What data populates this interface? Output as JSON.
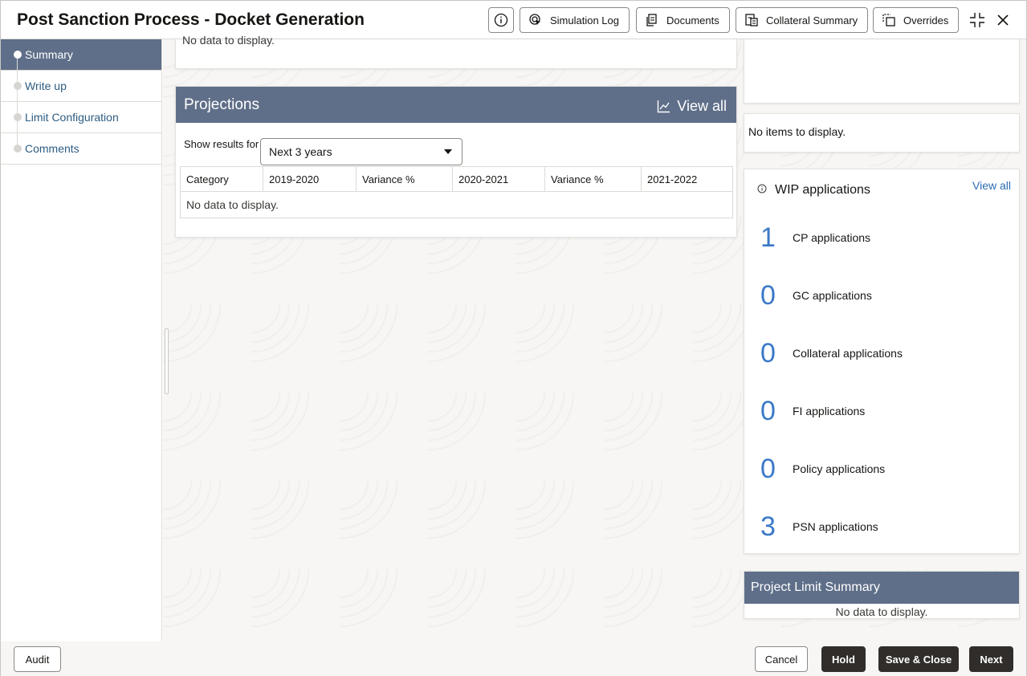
{
  "header": {
    "title": "Post Sanction Process - Docket Generation",
    "buttons": {
      "simulation_log": "Simulation Log",
      "documents": "Documents",
      "collateral_summary": "Collateral Summary",
      "overrides": "Overrides"
    }
  },
  "sidebar": {
    "items": [
      {
        "label": "Summary",
        "active": true
      },
      {
        "label": "Write up",
        "active": false
      },
      {
        "label": "Limit Configuration",
        "active": false
      },
      {
        "label": "Comments",
        "active": false
      }
    ]
  },
  "main": {
    "top_card_nodata": "No data to display.",
    "projections": {
      "title": "Projections",
      "view_all": "View all",
      "show_results_label": "Show results for",
      "selected_range": "Next 3 years",
      "columns": [
        "Category",
        "2019-2020",
        "Variance %",
        "2020-2021",
        "Variance %",
        "2021-2022"
      ],
      "empty_text": "No data to display."
    }
  },
  "right": {
    "items_empty": "No items to display.",
    "wip": {
      "title": "WIP applications",
      "view_all": "View all",
      "rows": [
        {
          "count": "1",
          "label": "CP applications"
        },
        {
          "count": "0",
          "label": "GC applications"
        },
        {
          "count": "0",
          "label": "Collateral applications"
        },
        {
          "count": "0",
          "label": "FI applications"
        },
        {
          "count": "0",
          "label": "Policy applications"
        },
        {
          "count": "3",
          "label": "PSN applications"
        }
      ]
    },
    "project_limit": {
      "title": "Project Limit Summary",
      "empty_text": "No data to display."
    }
  },
  "footer": {
    "audit": "Audit",
    "cancel": "Cancel",
    "hold": "Hold",
    "save_close": "Save & Close",
    "next": "Next"
  },
  "colors": {
    "panel_header": "#5f6f89",
    "link": "#2d6cb4",
    "count": "#3b79c8",
    "dark_button": "#312d2a"
  }
}
